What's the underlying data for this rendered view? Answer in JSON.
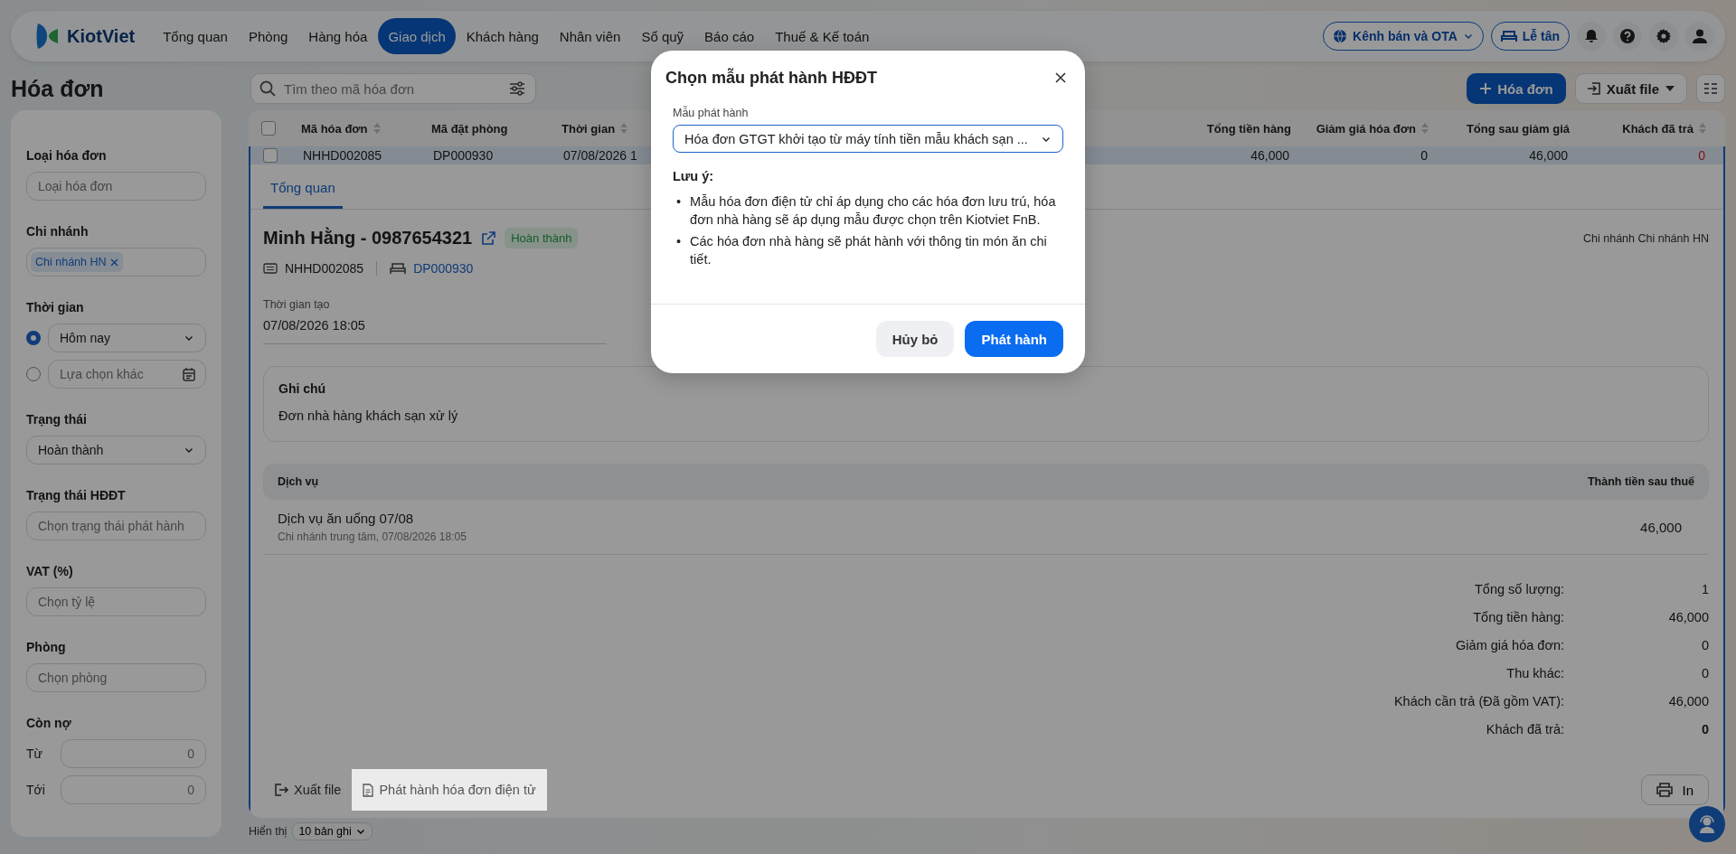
{
  "nav": {
    "logo": "KiotViet",
    "items": [
      {
        "label": "Tổng quan",
        "selected": false
      },
      {
        "label": "Phòng",
        "selected": false
      },
      {
        "label": "Hàng hóa",
        "selected": false
      },
      {
        "label": "Giao dịch",
        "selected": true
      },
      {
        "label": "Khách hàng",
        "selected": false
      },
      {
        "label": "Nhân viên",
        "selected": false
      },
      {
        "label": "Sổ quỹ",
        "selected": false
      },
      {
        "label": "Báo cáo",
        "selected": false
      },
      {
        "label": "Thuế & Kế toán",
        "selected": false
      }
    ],
    "channel_button": "Kênh bán và OTA",
    "reception_button": "Lễ tân"
  },
  "page_title": "Hóa đơn",
  "search": {
    "placeholder": "Tìm theo mã hóa đơn"
  },
  "actions": {
    "add": "Hóa đơn",
    "export": "Xuất file"
  },
  "filters": [
    {
      "kind": "field",
      "label": "Loại hóa đơn",
      "placeholder": "Loại hóa đơn"
    },
    {
      "kind": "tags",
      "label": "Chi nhánh",
      "tags": [
        "Chi nhánh HN"
      ]
    },
    {
      "kind": "radios",
      "label": "Thời gian",
      "options": [
        {
          "kind": "select",
          "value": "Hôm nay",
          "selected": true
        },
        {
          "kind": "date",
          "placeholder": "Lựa chọn khác",
          "selected": false
        }
      ]
    },
    {
      "kind": "select",
      "label": "Trạng thái",
      "value": "Hoàn thành"
    },
    {
      "kind": "field",
      "label": "Trạng thái HĐĐT",
      "placeholder": "Chọn trạng thái phát hành"
    },
    {
      "kind": "field",
      "label": "VAT (%)",
      "placeholder": "Chọn tỷ lệ"
    },
    {
      "kind": "field",
      "label": "Phòng",
      "placeholder": "Chọn phòng"
    },
    {
      "kind": "range",
      "label": "Còn nợ",
      "rows": [
        {
          "label": "Từ",
          "placeholder": "0"
        },
        {
          "label": "Tới",
          "placeholder": "0"
        }
      ]
    }
  ],
  "table": {
    "all_checked": false,
    "columns": [
      {
        "label": "Mã hóa đơn",
        "sortable": true
      },
      {
        "label": "Mã đặt phòng",
        "sortable": false
      },
      {
        "label": "Thời gian",
        "sortable": true
      },
      {
        "label": "Tổng tiền hàng",
        "sortable": false
      },
      {
        "label": "Giảm giá hóa đơn",
        "sortable": true
      },
      {
        "label": "Tổng sau giảm giá",
        "sortable": false
      },
      {
        "label": "Khách đã trả",
        "sortable": true
      }
    ],
    "rows": [
      {
        "cells": [
          "NHHD002085",
          "DP000930",
          "07/08/2026 1",
          "46,000",
          "0",
          "46,000",
          "0"
        ],
        "checked": false,
        "selected": true
      }
    ]
  },
  "detail": {
    "tabs": [
      {
        "label": "Tổng quan",
        "selected": true
      }
    ],
    "customer": "Minh Hằng - 0987654321",
    "status": "Hoàn thành",
    "branch": "Chi nhánh Chi nhánh HN",
    "invoice_code": "NHHD002085",
    "booking_code": "DP000930",
    "created_label": "Thời gian tạo",
    "created_value": "07/08/2026 18:05",
    "note": {
      "title": "Ghi chú",
      "text": "Đơn nhà hàng khách sạn xử lý"
    },
    "services": {
      "columns": [
        "Dịch vụ",
        "Thành tiền sau thuế"
      ],
      "items": [
        {
          "name": "Dịch vụ ăn uống 07/08",
          "sub": "Chi nhánh trung tâm, 07/08/2026 18:05",
          "amount": "46,000"
        }
      ]
    },
    "summary": [
      {
        "label": "Tổng số lượng:",
        "value": "1",
        "emphasis": false
      },
      {
        "label": "Tổng tiền hàng:",
        "value": "46,000",
        "emphasis": false
      },
      {
        "label": "Giảm giá hóa đơn:",
        "value": "0",
        "emphasis": false
      },
      {
        "label": "Thu khác:",
        "value": "0",
        "emphasis": false
      },
      {
        "label": "Khách cần trả (Đã gồm VAT):",
        "value": "46,000",
        "emphasis": false
      },
      {
        "label": "Khách đã trả:",
        "value": "0",
        "emphasis": true
      }
    ],
    "footer_actions": [
      {
        "label": "Xuất file",
        "kind": "export",
        "highlighted": false
      },
      {
        "label": "Phát hành hóa đơn điện tử",
        "kind": "document",
        "highlighted": true
      }
    ],
    "print": "In"
  },
  "pagination": {
    "label": "Hiển thị",
    "page_size": "10 bản ghi"
  },
  "modal": {
    "title": "Chọn mẫu phát hành HĐĐT",
    "field_label": "Mẫu phát hành",
    "value": "Hóa đơn GTGT khởi tạo từ máy tính tiền mẫu khách sạn ...",
    "note_title": "Lưu ý:",
    "marker": "•",
    "notes": [
      "Mẫu hóa đơn điện tử chỉ áp dụng cho các hóa đơn lưu trú, hóa đơn nhà hàng sẽ áp dụng mẫu được chọn trên Kiotviet FnB.",
      "Các hóa đơn nhà hàng sẽ phát hành với thông tin món ăn chi tiết."
    ],
    "buttons": [
      {
        "label": "Hủy bỏ",
        "kind": "secondary"
      },
      {
        "label": "Phát hành",
        "kind": "primary"
      }
    ]
  }
}
